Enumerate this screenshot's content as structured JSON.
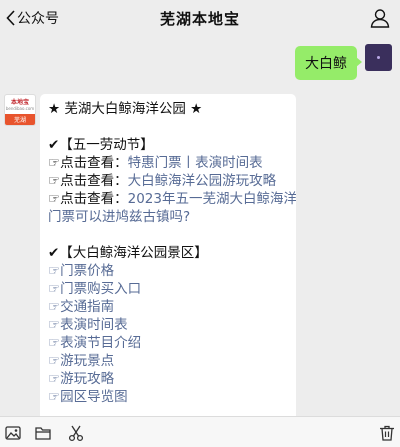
{
  "header": {
    "back_label": "公众号",
    "title": "芜湖本地宝"
  },
  "outgoing": {
    "text": "大白鲸"
  },
  "bot_avatar": {
    "top_text": "本地宝",
    "sub_text": "bendibao.com",
    "city": "芜湖"
  },
  "message": {
    "heading": "★ 芜湖大白鲸海洋公园 ★",
    "section1_title": "✔【五一劳动节】",
    "item1_prefix": "☞点击查看：",
    "item1_link_a": "特惠门票",
    "item1_sep": "丨",
    "item1_link_b": "表演时间表",
    "item2_prefix": "☞点击查看：",
    "item2_link": "大白鲸海洋公园游玩攻略",
    "item3_prefix": "☞点击查看：",
    "item3_link_l1": "2023年五一芜湖大白鲸海洋公园",
    "item3_link_l2": "门票可以进鸠兹古镇吗?",
    "section2_title": "✔【大白鲸海洋公园景区】",
    "links": [
      "☞门票价格",
      "☞门票购买入口",
      "☞交通指南",
      "☞表演时间表",
      "☞表演节目介绍",
      "☞游玩景点",
      "☞游玩攻略",
      "☞园区导览图"
    ]
  },
  "icons": {
    "user": "user-icon",
    "image": "image-icon",
    "folder": "folder-icon",
    "scissors": "scissors-icon",
    "delete": "trash-icon"
  }
}
